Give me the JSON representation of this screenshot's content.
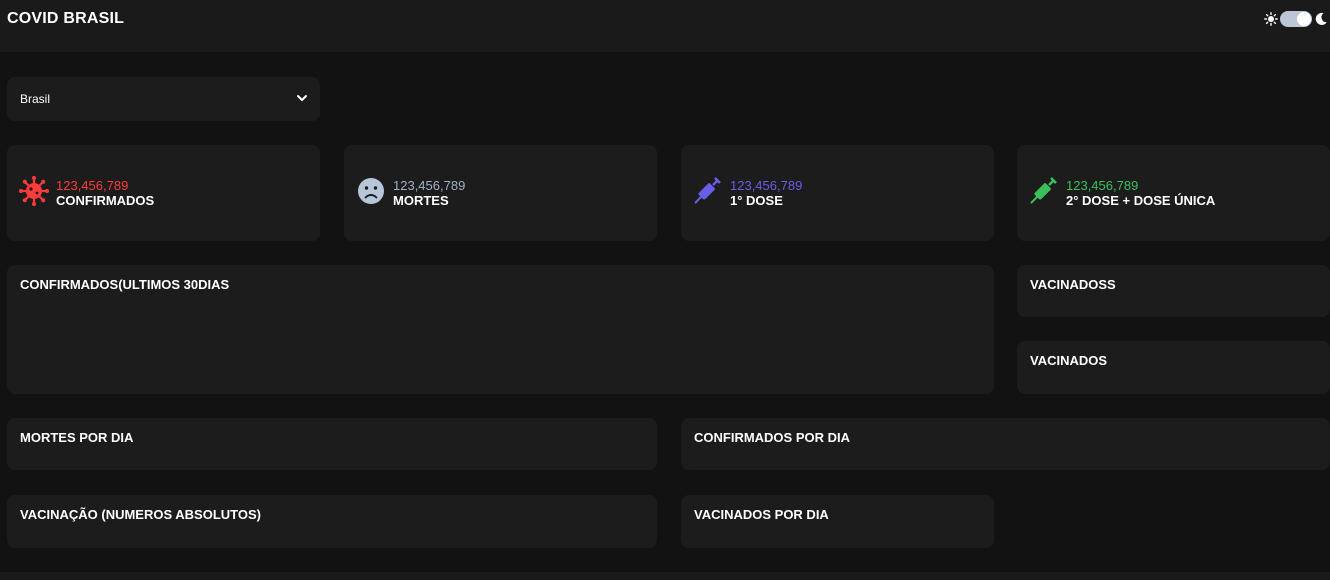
{
  "header": {
    "title": "COVID BRASIL",
    "theme_toggle": {
      "left_icon": "sun-icon",
      "right_icon": "moon-icon",
      "state": "dark"
    }
  },
  "location_select": {
    "value": "Brasil",
    "icon": "chevron-down-icon"
  },
  "stats": [
    {
      "number": "123,456,789",
      "label": "CONFIRMADOS",
      "color": "#ff3b3b",
      "icon": "virus-icon"
    },
    {
      "number": "123,456,789",
      "label": "MORTES",
      "color": "#9fb0c8",
      "icon": "sad-face-icon"
    },
    {
      "number": "123,456,789",
      "label": "1° DOSE",
      "color": "#6a5ee6",
      "icon": "syringe-icon"
    },
    {
      "number": "123,456,789",
      "label": "2° DOSE + DOSE ÚNICA",
      "color": "#39c05a",
      "icon": "syringe-icon"
    }
  ],
  "panels": {
    "confirmed_30": "CONFIRMADOS(ULTIMOS 30DIAS",
    "vaccinated_a": "VACINADOSS",
    "vaccinated_b": "VACINADOS",
    "deaths_per_day": "MORTES POR DIA",
    "confirmed_per_day": "CONFIRMADOS POR DIA",
    "vaccination_absolute": "VACINAÇÃO (NUMEROS ABSOLUTOS)",
    "vaccinated_per_day": "VACINADOS POR DIA"
  },
  "colors": {
    "background": "#121212",
    "card": "#1c1c1c",
    "confirmed": "#ff3b3b",
    "deaths": "#9fb0c8",
    "dose1": "#6a5ee6",
    "dose2": "#39c05a"
  }
}
